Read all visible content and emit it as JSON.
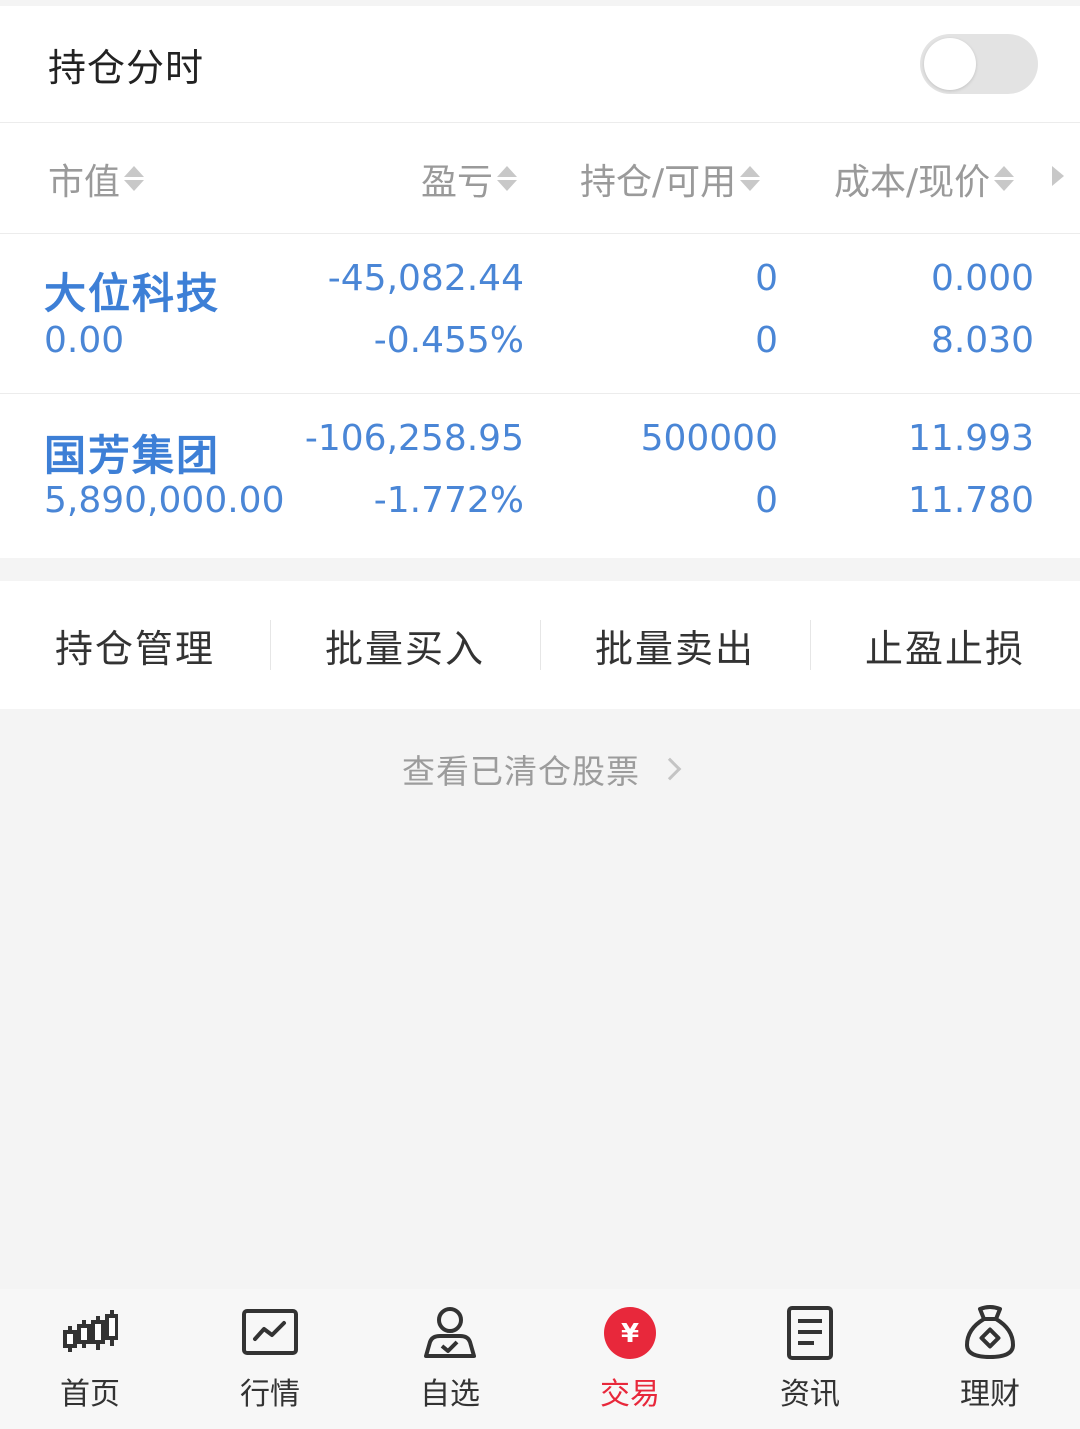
{
  "toggle": {
    "title": "持仓分时",
    "on": false
  },
  "header": {
    "col1": "市值",
    "col2": "盈亏",
    "col3": "持仓/可用",
    "col4": "成本/现价"
  },
  "rows": [
    {
      "name": "大位科技",
      "market_value": "0.00",
      "pnl": "-45,082.44",
      "pnl_pct": "-0.455%",
      "position": "0",
      "available": "0",
      "cost": "0.000",
      "price": "8.030"
    },
    {
      "name": "国芳集团",
      "market_value": "5,890,000.00",
      "pnl": "-106,258.95",
      "pnl_pct": "-1.772%",
      "position": "500000",
      "available": "0",
      "cost": "11.993",
      "price": "11.780"
    }
  ],
  "actions": [
    "持仓管理",
    "批量买入",
    "批量卖出",
    "止盈止损"
  ],
  "cleared_link": "查看已清仓股票",
  "nav": [
    {
      "label": "首页",
      "icon": "candlestick-icon",
      "active": false
    },
    {
      "label": "行情",
      "icon": "chart-line-icon",
      "active": false
    },
    {
      "label": "自选",
      "icon": "person-check-icon",
      "active": false
    },
    {
      "label": "交易",
      "icon": "yuan-circle-icon",
      "active": true
    },
    {
      "label": "资讯",
      "icon": "document-icon",
      "active": false
    },
    {
      "label": "理财",
      "icon": "money-bag-icon",
      "active": false
    }
  ],
  "colors": {
    "accent_blue": "#4a86d6",
    "active_red": "#e8283b"
  }
}
